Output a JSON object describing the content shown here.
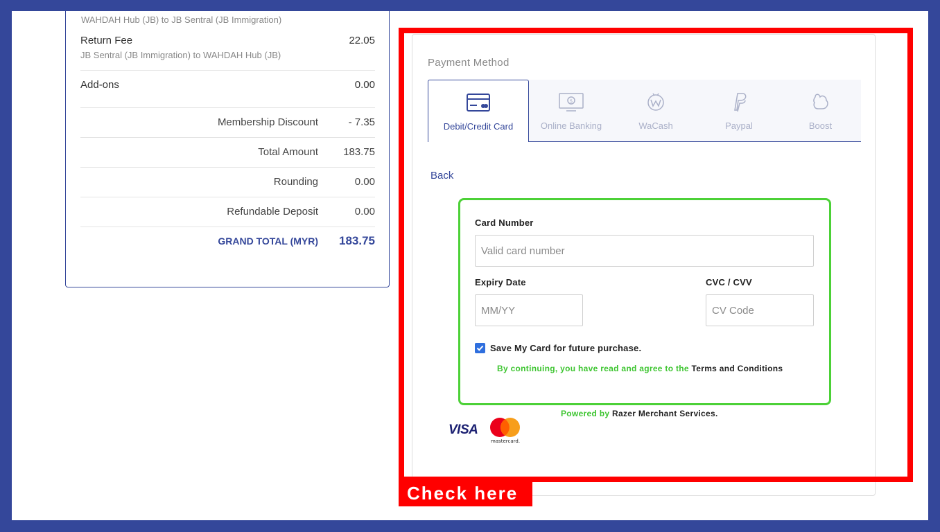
{
  "summary": {
    "cut_off_text": "WAHDAH Hub (JB) to JB Sentral (JB Immigration)",
    "return_fee": {
      "label": "Return Fee",
      "route": "JB Sentral (JB Immigration) to WAHDAH Hub (JB)",
      "value": "22.05"
    },
    "addons": {
      "label": "Add-ons",
      "value": "0.00"
    },
    "totals": [
      {
        "label": "Membership Discount",
        "value": "- 7.35"
      },
      {
        "label": "Total Amount",
        "value": "183.75"
      },
      {
        "label": "Rounding",
        "value": "0.00"
      },
      {
        "label": "Refundable Deposit",
        "value": "0.00"
      }
    ],
    "grand_total": {
      "label": "GRAND TOTAL (MYR)",
      "value": "183.75"
    }
  },
  "payment": {
    "title": "Payment Method",
    "tabs": [
      {
        "label": "Debit/Credit Card",
        "icon": "credit-card-icon",
        "active": true
      },
      {
        "label": "Online Banking",
        "icon": "online-banking-icon",
        "active": false
      },
      {
        "label": "WaCash",
        "icon": "wacash-icon",
        "active": false
      },
      {
        "label": "Paypal",
        "icon": "paypal-icon",
        "active": false
      },
      {
        "label": "Boost",
        "icon": "boost-icon",
        "active": false
      }
    ],
    "back_label": "Back",
    "form": {
      "card_number_label": "Card Number",
      "card_number_placeholder": "Valid card number",
      "expiry_label": "Expiry Date",
      "expiry_placeholder": "MM/YY",
      "cvc_label": "CVC / CVV",
      "cvc_placeholder": "CV Code",
      "save_card_label": "Save My Card for future purchase.",
      "save_card_checked": true,
      "consent_prefix": "By continuing, you have read and agree to the ",
      "consent_link": "Terms and Conditions"
    },
    "powered_prefix": "Powered by ",
    "powered_name": "Razer Merchant Services.",
    "visa_label": "VISA",
    "mastercard_label": "mastercard."
  },
  "annotation": {
    "label": "Check here"
  },
  "colors": {
    "frame": "#34479a",
    "highlight": "#ff0000",
    "form_border": "#4cd137",
    "accent": "#34479a"
  }
}
